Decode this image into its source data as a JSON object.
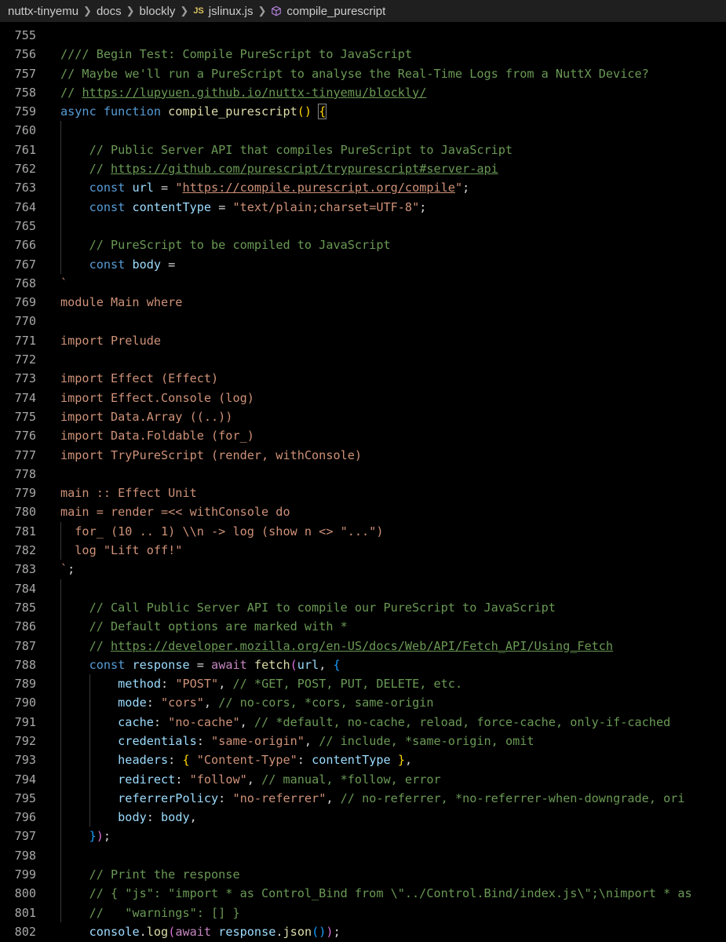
{
  "breadcrumb": {
    "items": [
      "nuttx-tinyemu",
      "docs",
      "blockly"
    ],
    "file_badge": "JS",
    "file": "jslinux.js",
    "symbol": "compile_purescript"
  },
  "colors": {
    "comment": "#6a9955",
    "keyword": "#569cd6",
    "function": "#dcdcaa",
    "variable": "#9cdcfe",
    "string": "#ce9178",
    "bracket_gold": "#ffd700",
    "bracket_purple": "#da70d6",
    "bracket_blue": "#179fff"
  },
  "editor": {
    "lines": [
      {
        "num": "755",
        "tokens": []
      },
      {
        "num": "756",
        "tokens": [
          {
            "t": "c",
            "v": "//// Begin Test: Compile PureScript to JavaScript"
          }
        ]
      },
      {
        "num": "757",
        "tokens": [
          {
            "t": "c",
            "v": "// Maybe we'll run a PureScript to analyse the Real-Time Logs from a NuttX Device?"
          }
        ]
      },
      {
        "num": "758",
        "tokens": [
          {
            "t": "c",
            "v": "// "
          },
          {
            "t": "c u",
            "v": "https://lupyuen.github.io/nuttx-tinyemu/blockly/"
          }
        ]
      },
      {
        "num": "759",
        "tokens": [
          {
            "t": "kw",
            "v": "async function "
          },
          {
            "t": "fn",
            "v": "compile_purescript"
          },
          {
            "t": "br1",
            "v": "() "
          },
          {
            "t": "br1 hl",
            "v": "{"
          }
        ]
      },
      {
        "num": "760",
        "tokens": []
      },
      {
        "num": "761",
        "tokens": [
          {
            "t": "pl",
            "v": "    "
          },
          {
            "t": "c",
            "v": "// Public Server API that compiles PureScript to JavaScript"
          }
        ]
      },
      {
        "num": "762",
        "tokens": [
          {
            "t": "pl",
            "v": "    "
          },
          {
            "t": "c",
            "v": "// "
          },
          {
            "t": "c u",
            "v": "https://github.com/purescript/trypurescript#server-api"
          }
        ]
      },
      {
        "num": "763",
        "tokens": [
          {
            "t": "pl",
            "v": "    "
          },
          {
            "t": "kw",
            "v": "const "
          },
          {
            "t": "vr",
            "v": "url"
          },
          {
            "t": "pl",
            "v": " = "
          },
          {
            "t": "st",
            "v": "\""
          },
          {
            "t": "st u",
            "v": "https://compile.purescript.org/compile"
          },
          {
            "t": "st",
            "v": "\""
          },
          {
            "t": "pl",
            "v": ";"
          }
        ]
      },
      {
        "num": "764",
        "tokens": [
          {
            "t": "pl",
            "v": "    "
          },
          {
            "t": "kw",
            "v": "const "
          },
          {
            "t": "vr",
            "v": "contentType"
          },
          {
            "t": "pl",
            "v": " = "
          },
          {
            "t": "st",
            "v": "\"text/plain;charset=UTF-8\""
          },
          {
            "t": "pl",
            "v": ";"
          }
        ]
      },
      {
        "num": "765",
        "tokens": []
      },
      {
        "num": "766",
        "tokens": [
          {
            "t": "pl",
            "v": "    "
          },
          {
            "t": "c",
            "v": "// PureScript to be compiled to JavaScript"
          }
        ]
      },
      {
        "num": "767",
        "tokens": [
          {
            "t": "pl",
            "v": "    "
          },
          {
            "t": "kw",
            "v": "const "
          },
          {
            "t": "vr",
            "v": "body"
          },
          {
            "t": "pl",
            "v": " ="
          }
        ]
      },
      {
        "num": "768",
        "tokens": [
          {
            "t": "st",
            "v": "`"
          }
        ]
      },
      {
        "num": "769",
        "tokens": [
          {
            "t": "st",
            "v": "module Main where"
          }
        ]
      },
      {
        "num": "770",
        "tokens": []
      },
      {
        "num": "771",
        "tokens": [
          {
            "t": "st",
            "v": "import Prelude"
          }
        ]
      },
      {
        "num": "772",
        "tokens": []
      },
      {
        "num": "773",
        "tokens": [
          {
            "t": "st",
            "v": "import Effect (Effect)"
          }
        ]
      },
      {
        "num": "774",
        "tokens": [
          {
            "t": "st",
            "v": "import Effect.Console (log)"
          }
        ]
      },
      {
        "num": "775",
        "tokens": [
          {
            "t": "st",
            "v": "import Data.Array ((..))"
          }
        ]
      },
      {
        "num": "776",
        "tokens": [
          {
            "t": "st",
            "v": "import Data.Foldable (for_)"
          }
        ]
      },
      {
        "num": "777",
        "tokens": [
          {
            "t": "st",
            "v": "import TryPureScript (render, withConsole)"
          }
        ]
      },
      {
        "num": "778",
        "tokens": []
      },
      {
        "num": "779",
        "tokens": [
          {
            "t": "st",
            "v": "main :: Effect Unit"
          }
        ]
      },
      {
        "num": "780",
        "tokens": [
          {
            "t": "st",
            "v": "main = render =<< withConsole do"
          }
        ]
      },
      {
        "num": "781",
        "tokens": [
          {
            "t": "st",
            "v": "  for_ (10 .. 1) \\\\n -> log (show n <> \"...\")"
          }
        ]
      },
      {
        "num": "782",
        "tokens": [
          {
            "t": "st",
            "v": "  log \"Lift off!\""
          }
        ]
      },
      {
        "num": "783",
        "tokens": [
          {
            "t": "st",
            "v": "`"
          },
          {
            "t": "pl",
            "v": ";"
          }
        ]
      },
      {
        "num": "784",
        "tokens": []
      },
      {
        "num": "785",
        "tokens": [
          {
            "t": "pl",
            "v": "    "
          },
          {
            "t": "c",
            "v": "// Call Public Server API to compile our PureScript to JavaScript"
          }
        ]
      },
      {
        "num": "786",
        "tokens": [
          {
            "t": "pl",
            "v": "    "
          },
          {
            "t": "c",
            "v": "// Default options are marked with *"
          }
        ]
      },
      {
        "num": "787",
        "tokens": [
          {
            "t": "pl",
            "v": "    "
          },
          {
            "t": "c",
            "v": "// "
          },
          {
            "t": "c u",
            "v": "https://developer.mozilla.org/en-US/docs/Web/API/Fetch_API/Using_Fetch"
          }
        ]
      },
      {
        "num": "788",
        "tokens": [
          {
            "t": "pl",
            "v": "    "
          },
          {
            "t": "kw",
            "v": "const "
          },
          {
            "t": "vr",
            "v": "response"
          },
          {
            "t": "pl",
            "v": " = "
          },
          {
            "t": "aw",
            "v": "await "
          },
          {
            "t": "fn",
            "v": "fetch"
          },
          {
            "t": "br2",
            "v": "("
          },
          {
            "t": "vr",
            "v": "url"
          },
          {
            "t": "pl",
            "v": ", "
          },
          {
            "t": "br3",
            "v": "{"
          }
        ]
      },
      {
        "num": "789",
        "tokens": [
          {
            "t": "pl",
            "v": "        "
          },
          {
            "t": "vr",
            "v": "method"
          },
          {
            "t": "pl",
            "v": ": "
          },
          {
            "t": "st",
            "v": "\"POST\""
          },
          {
            "t": "pl",
            "v": ", "
          },
          {
            "t": "c",
            "v": "// *GET, POST, PUT, DELETE, etc."
          }
        ]
      },
      {
        "num": "790",
        "tokens": [
          {
            "t": "pl",
            "v": "        "
          },
          {
            "t": "vr",
            "v": "mode"
          },
          {
            "t": "pl",
            "v": ": "
          },
          {
            "t": "st",
            "v": "\"cors\""
          },
          {
            "t": "pl",
            "v": ", "
          },
          {
            "t": "c",
            "v": "// no-cors, *cors, same-origin"
          }
        ]
      },
      {
        "num": "791",
        "tokens": [
          {
            "t": "pl",
            "v": "        "
          },
          {
            "t": "vr",
            "v": "cache"
          },
          {
            "t": "pl",
            "v": ": "
          },
          {
            "t": "st",
            "v": "\"no-cache\""
          },
          {
            "t": "pl",
            "v": ", "
          },
          {
            "t": "c",
            "v": "// *default, no-cache, reload, force-cache, only-if-cached"
          }
        ]
      },
      {
        "num": "792",
        "tokens": [
          {
            "t": "pl",
            "v": "        "
          },
          {
            "t": "vr",
            "v": "credentials"
          },
          {
            "t": "pl",
            "v": ": "
          },
          {
            "t": "st",
            "v": "\"same-origin\""
          },
          {
            "t": "pl",
            "v": ", "
          },
          {
            "t": "c",
            "v": "// include, *same-origin, omit"
          }
        ]
      },
      {
        "num": "793",
        "tokens": [
          {
            "t": "pl",
            "v": "        "
          },
          {
            "t": "vr",
            "v": "headers"
          },
          {
            "t": "pl",
            "v": ": "
          },
          {
            "t": "br1",
            "v": "{ "
          },
          {
            "t": "st",
            "v": "\"Content-Type\""
          },
          {
            "t": "pl",
            "v": ": "
          },
          {
            "t": "vr",
            "v": "contentType"
          },
          {
            "t": "br1",
            "v": " }"
          },
          {
            "t": "pl",
            "v": ","
          }
        ]
      },
      {
        "num": "794",
        "tokens": [
          {
            "t": "pl",
            "v": "        "
          },
          {
            "t": "vr",
            "v": "redirect"
          },
          {
            "t": "pl",
            "v": ": "
          },
          {
            "t": "st",
            "v": "\"follow\""
          },
          {
            "t": "pl",
            "v": ", "
          },
          {
            "t": "c",
            "v": "// manual, *follow, error"
          }
        ]
      },
      {
        "num": "795",
        "tokens": [
          {
            "t": "pl",
            "v": "        "
          },
          {
            "t": "vr",
            "v": "referrerPolicy"
          },
          {
            "t": "pl",
            "v": ": "
          },
          {
            "t": "st",
            "v": "\"no-referrer\""
          },
          {
            "t": "pl",
            "v": ", "
          },
          {
            "t": "c",
            "v": "// no-referrer, *no-referrer-when-downgrade, ori"
          }
        ]
      },
      {
        "num": "796",
        "tokens": [
          {
            "t": "pl",
            "v": "        "
          },
          {
            "t": "vr",
            "v": "body"
          },
          {
            "t": "pl",
            "v": ": "
          },
          {
            "t": "vr",
            "v": "body"
          },
          {
            "t": "pl",
            "v": ","
          }
        ]
      },
      {
        "num": "797",
        "tokens": [
          {
            "t": "pl",
            "v": "    "
          },
          {
            "t": "br3",
            "v": "}"
          },
          {
            "t": "br2",
            "v": ")"
          },
          {
            "t": "pl",
            "v": ";"
          }
        ]
      },
      {
        "num": "798",
        "tokens": []
      },
      {
        "num": "799",
        "tokens": [
          {
            "t": "pl",
            "v": "    "
          },
          {
            "t": "c",
            "v": "// Print the response"
          }
        ]
      },
      {
        "num": "800",
        "tokens": [
          {
            "t": "pl",
            "v": "    "
          },
          {
            "t": "c",
            "v": "// { \"js\": \"import * as Control_Bind from \\\"../Control.Bind/index.js\\\";\\nimport * as"
          }
        ]
      },
      {
        "num": "801",
        "tokens": [
          {
            "t": "pl",
            "v": "    "
          },
          {
            "t": "c",
            "v": "//   \"warnings\": [] }"
          }
        ]
      },
      {
        "num": "802",
        "tokens": [
          {
            "t": "pl",
            "v": "    "
          },
          {
            "t": "vr",
            "v": "console"
          },
          {
            "t": "pl",
            "v": "."
          },
          {
            "t": "fn",
            "v": "log"
          },
          {
            "t": "br2",
            "v": "("
          },
          {
            "t": "aw",
            "v": "await "
          },
          {
            "t": "vr",
            "v": "response"
          },
          {
            "t": "pl",
            "v": "."
          },
          {
            "t": "fn",
            "v": "json"
          },
          {
            "t": "br3",
            "v": "()"
          },
          {
            "t": "br2",
            "v": ")"
          },
          {
            "t": "pl",
            "v": ";"
          }
        ]
      }
    ]
  }
}
